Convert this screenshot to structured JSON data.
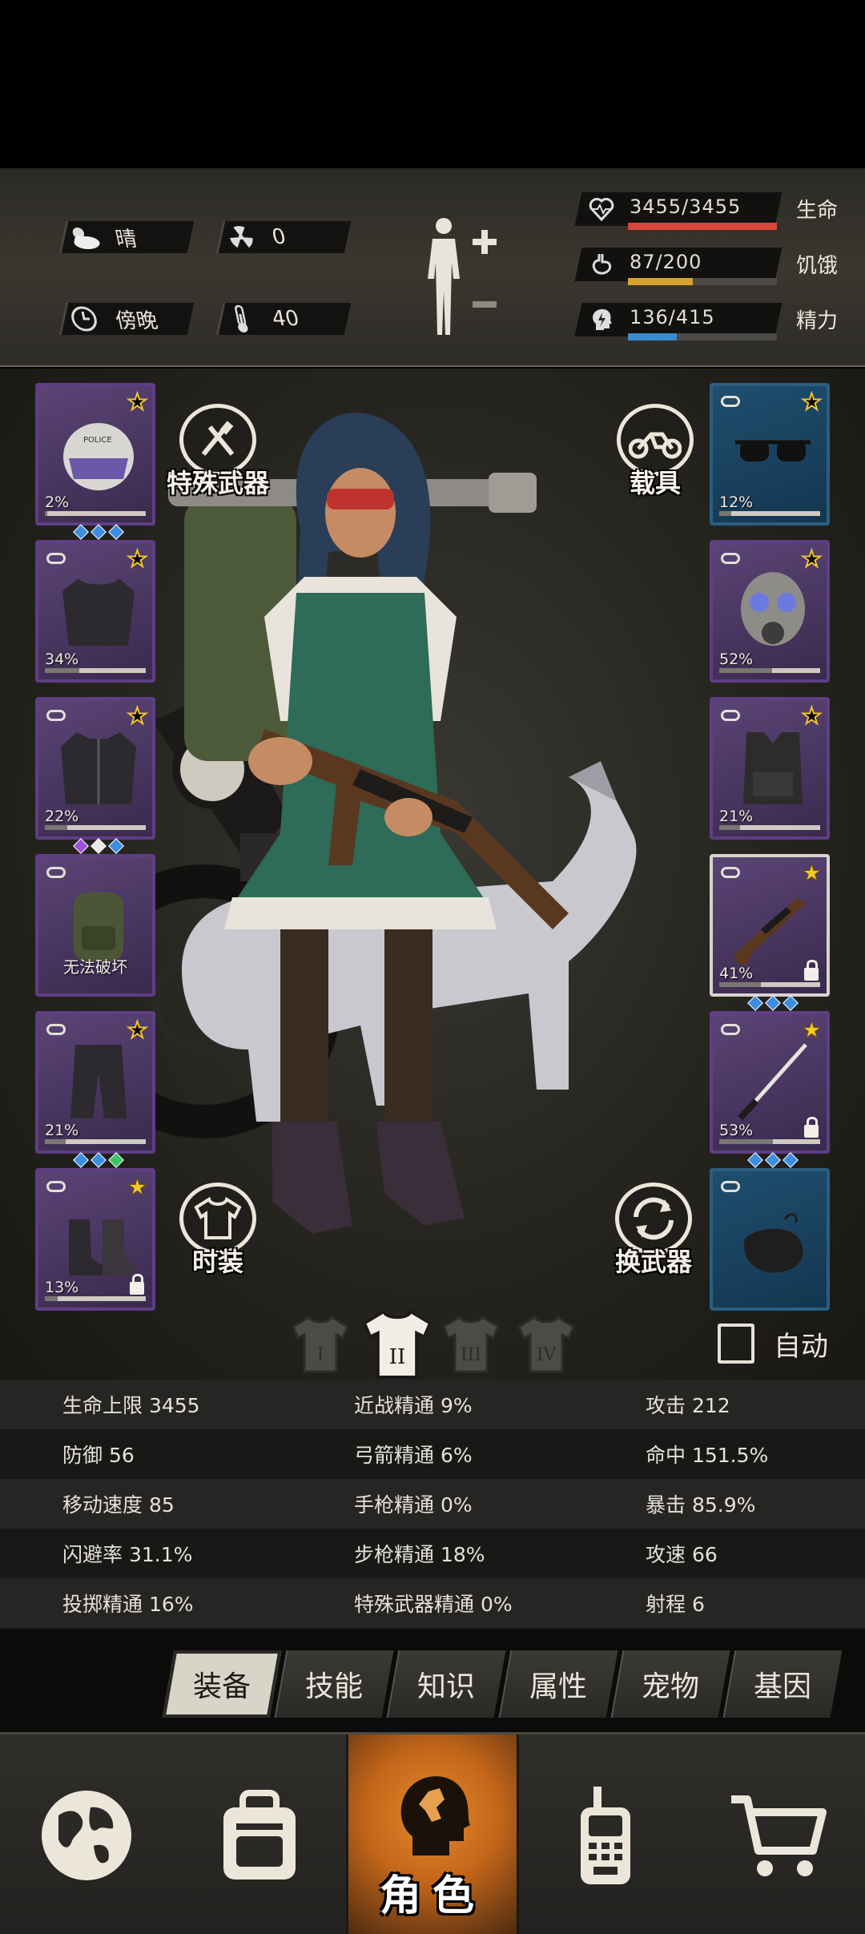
{
  "header": {
    "weather": "晴",
    "radiation": "0",
    "time_of_day": "傍晚",
    "temperature": "40",
    "health": {
      "value": "3455/3455",
      "label": "生命",
      "fraction": 1.0,
      "color": "#d9453a"
    },
    "hunger": {
      "value": "87/200",
      "label": "饥饿",
      "fraction": 0.435,
      "color": "#d8a32e"
    },
    "energy": {
      "value": "136/415",
      "label": "精力",
      "fraction": 0.328,
      "color": "#3a8bd0"
    }
  },
  "scene": {
    "special_weapon_label": "特殊武器",
    "vehicle_label": "载具",
    "fashion_label": "时装",
    "switch_weapon_label": "换武器",
    "auto_label": "自动",
    "outfits": [
      "I",
      "II",
      "III",
      "IV"
    ],
    "active_outfit": "II"
  },
  "left_slots": [
    {
      "name": "helmet",
      "pct": "2%",
      "durability": 0.02,
      "star": "outline",
      "gems": [
        "#3d8ee0",
        "#3d8ee0",
        "#3d8ee0"
      ]
    },
    {
      "name": "shirt",
      "pct": "34%",
      "durability": 0.34,
      "star": "outline",
      "gems": []
    },
    {
      "name": "jacket",
      "pct": "22%",
      "durability": 0.22,
      "star": "outline",
      "gems": [
        "#a14fd6",
        "#e8e8e8",
        "#3d8ee0"
      ]
    },
    {
      "name": "backpack",
      "text": "无法破坏",
      "star": "none",
      "gems": []
    },
    {
      "name": "pants",
      "pct": "21%",
      "durability": 0.21,
      "star": "outline",
      "gems": [
        "#3d8ee0",
        "#3d8ee0",
        "#3ec46a"
      ]
    },
    {
      "name": "boots",
      "pct": "13%",
      "durability": 0.13,
      "star": "filled",
      "gems": []
    }
  ],
  "right_slots": [
    {
      "name": "glasses",
      "pct": "12%",
      "durability": 0.12,
      "star": "outline",
      "gems": []
    },
    {
      "name": "gas-mask",
      "pct": "52%",
      "durability": 0.52,
      "star": "outline",
      "gems": []
    },
    {
      "name": "vest",
      "pct": "21%",
      "durability": 0.21,
      "star": "outline",
      "gems": []
    },
    {
      "name": "rifle",
      "pct": "41%",
      "durability": 0.41,
      "star": "filled",
      "gems": [
        "#3d8ee0",
        "#3d8ee0",
        "#3d8ee0"
      ]
    },
    {
      "name": "katana",
      "pct": "53%",
      "durability": 0.53,
      "star": "filled",
      "gems": [
        "#3d8ee0",
        "#3d8ee0",
        "#3d8ee0"
      ]
    },
    {
      "name": "sack",
      "star": "none",
      "gems": []
    }
  ],
  "stats": [
    [
      "生命上限 3455",
      "近战精通 9%",
      "攻击 212"
    ],
    [
      "防御 56",
      "弓箭精通 6%",
      "命中 151.5%"
    ],
    [
      "移动速度 85",
      "手枪精通 0%",
      "暴击 85.9%"
    ],
    [
      "闪避率 31.1%",
      "步枪精通 18%",
      "攻速 66"
    ],
    [
      "投掷精通 16%",
      "特殊武器精通 0%",
      "射程 6"
    ]
  ],
  "subtabs": [
    "装备",
    "技能",
    "知识",
    "属性",
    "宠物",
    "基因"
  ],
  "active_subtab": "装备",
  "nav": {
    "active_label": "角色"
  }
}
